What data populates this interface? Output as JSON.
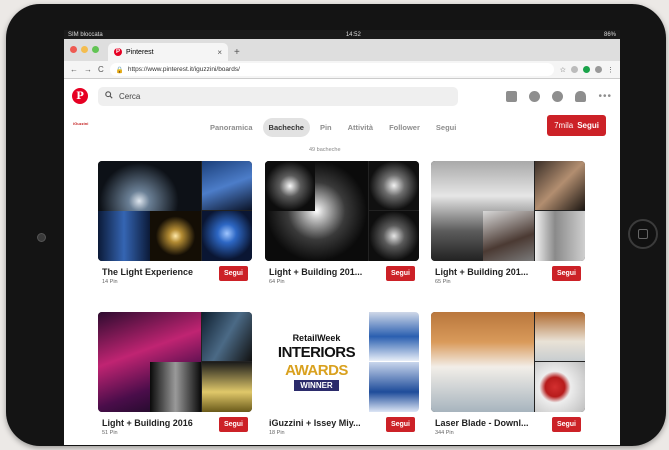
{
  "status_bar": {
    "carrier": "SIM bloccata",
    "time": "14:52",
    "battery": "86%"
  },
  "browser": {
    "tab_title": "Pinterest",
    "url": "https://www.pinterest.it/iguzzini/boards/"
  },
  "header": {
    "search_placeholder": "Cerca"
  },
  "profile": {
    "brand": "iGuzzini",
    "tabs": [
      {
        "label": "Panoramica"
      },
      {
        "label": "Bacheche"
      },
      {
        "label": "Pin"
      },
      {
        "label": "Attività"
      },
      {
        "label": "Follower"
      },
      {
        "label": "Segui"
      }
    ],
    "board_count": "49 bacheche",
    "follow_count": "7mila",
    "follow_label": "Segui"
  },
  "boards": [
    {
      "title": "The Light Experience",
      "pins": "14 Pin",
      "follow": "Segui"
    },
    {
      "title": "Light + Building 201...",
      "pins": "64 Pin",
      "follow": "Segui"
    },
    {
      "title": "Light + Building 201...",
      "pins": "65 Pin",
      "follow": "Segui"
    },
    {
      "title": "Light + Building 2016",
      "pins": "51 Pin",
      "follow": "Segui"
    },
    {
      "title": "iGuzzini + Issey Miy...",
      "pins": "18 Pin",
      "follow": "Segui"
    },
    {
      "title": "Laser Blade - Downl...",
      "pins": "344 Pin",
      "follow": "Segui"
    }
  ],
  "award_image": {
    "line1": "RetailWeek",
    "line2": "INTERIORS",
    "line3": "AWARDS",
    "line4": "WINNER"
  },
  "colors": {
    "brand_red": "#e60023",
    "button_red": "#cc2127"
  },
  "icons": [
    "pinterest-logo-icon",
    "search-icon",
    "people-icon",
    "profile-icon",
    "chat-icon",
    "bell-icon",
    "more-icon",
    "back-icon",
    "forward-icon",
    "reload-icon",
    "lock-icon",
    "star-icon"
  ]
}
